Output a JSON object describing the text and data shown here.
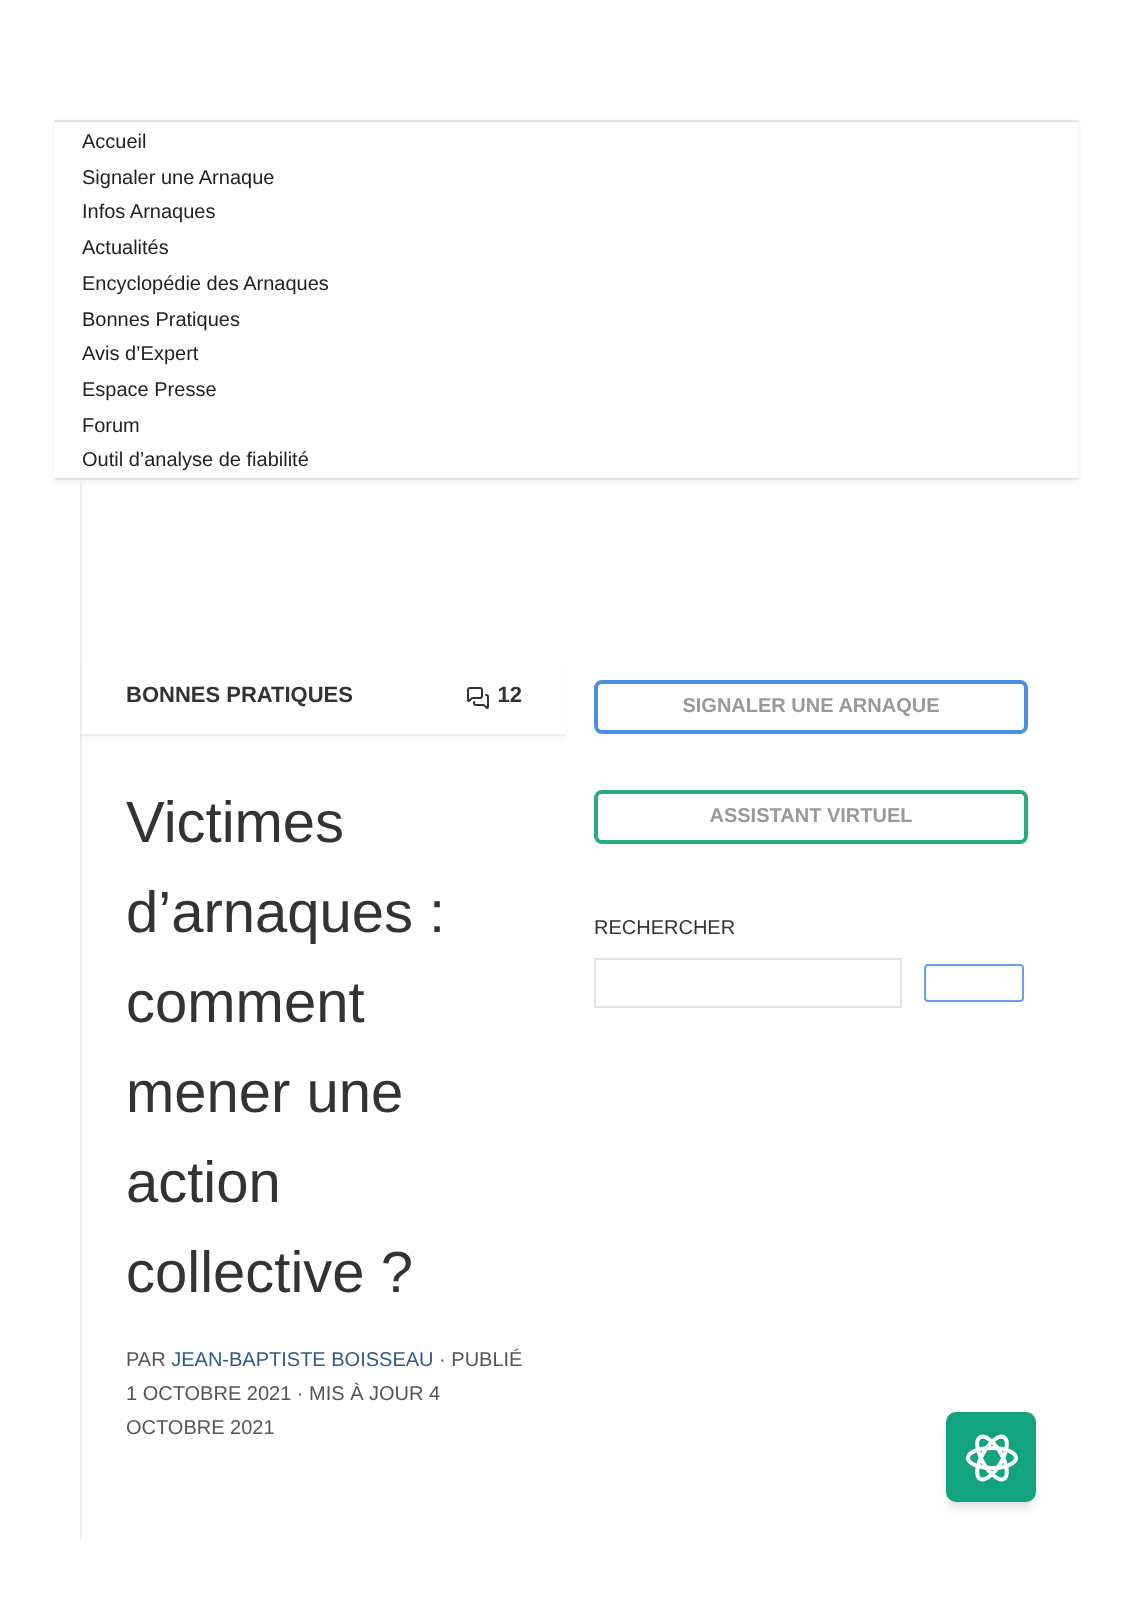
{
  "menu": {
    "items": [
      "Accueil",
      "Signaler une Arnaque",
      "Infos Arnaques",
      "Actualités",
      "Encyclopédie des Arnaques",
      "Bonnes Pratiques",
      "Avis d’Expert",
      "Espace Presse",
      "Forum",
      "Outil d’analyse de fiabilité"
    ]
  },
  "article": {
    "category": "BONNES PRATIQUES",
    "comments": "12",
    "title": "Victimes d’arnaques : comment mener une action collective ?",
    "meta": {
      "prefix": "PAR ",
      "author": "JEAN-BAPTISTE BOISSEAU",
      "suffix": " · PUBLIÉ 1 OCTOBRE 2021 · MIS À JOUR 4 OCTOBRE 2021"
    }
  },
  "sidebar": {
    "buttons": [
      {
        "label": "SIGNALER UNE ARNAQUE",
        "color": "#4a90e2"
      },
      {
        "label": "ASSISTANT VIRTUEL",
        "color": "#2baa7e"
      }
    ],
    "search": {
      "label": "RECHERCHER"
    }
  }
}
